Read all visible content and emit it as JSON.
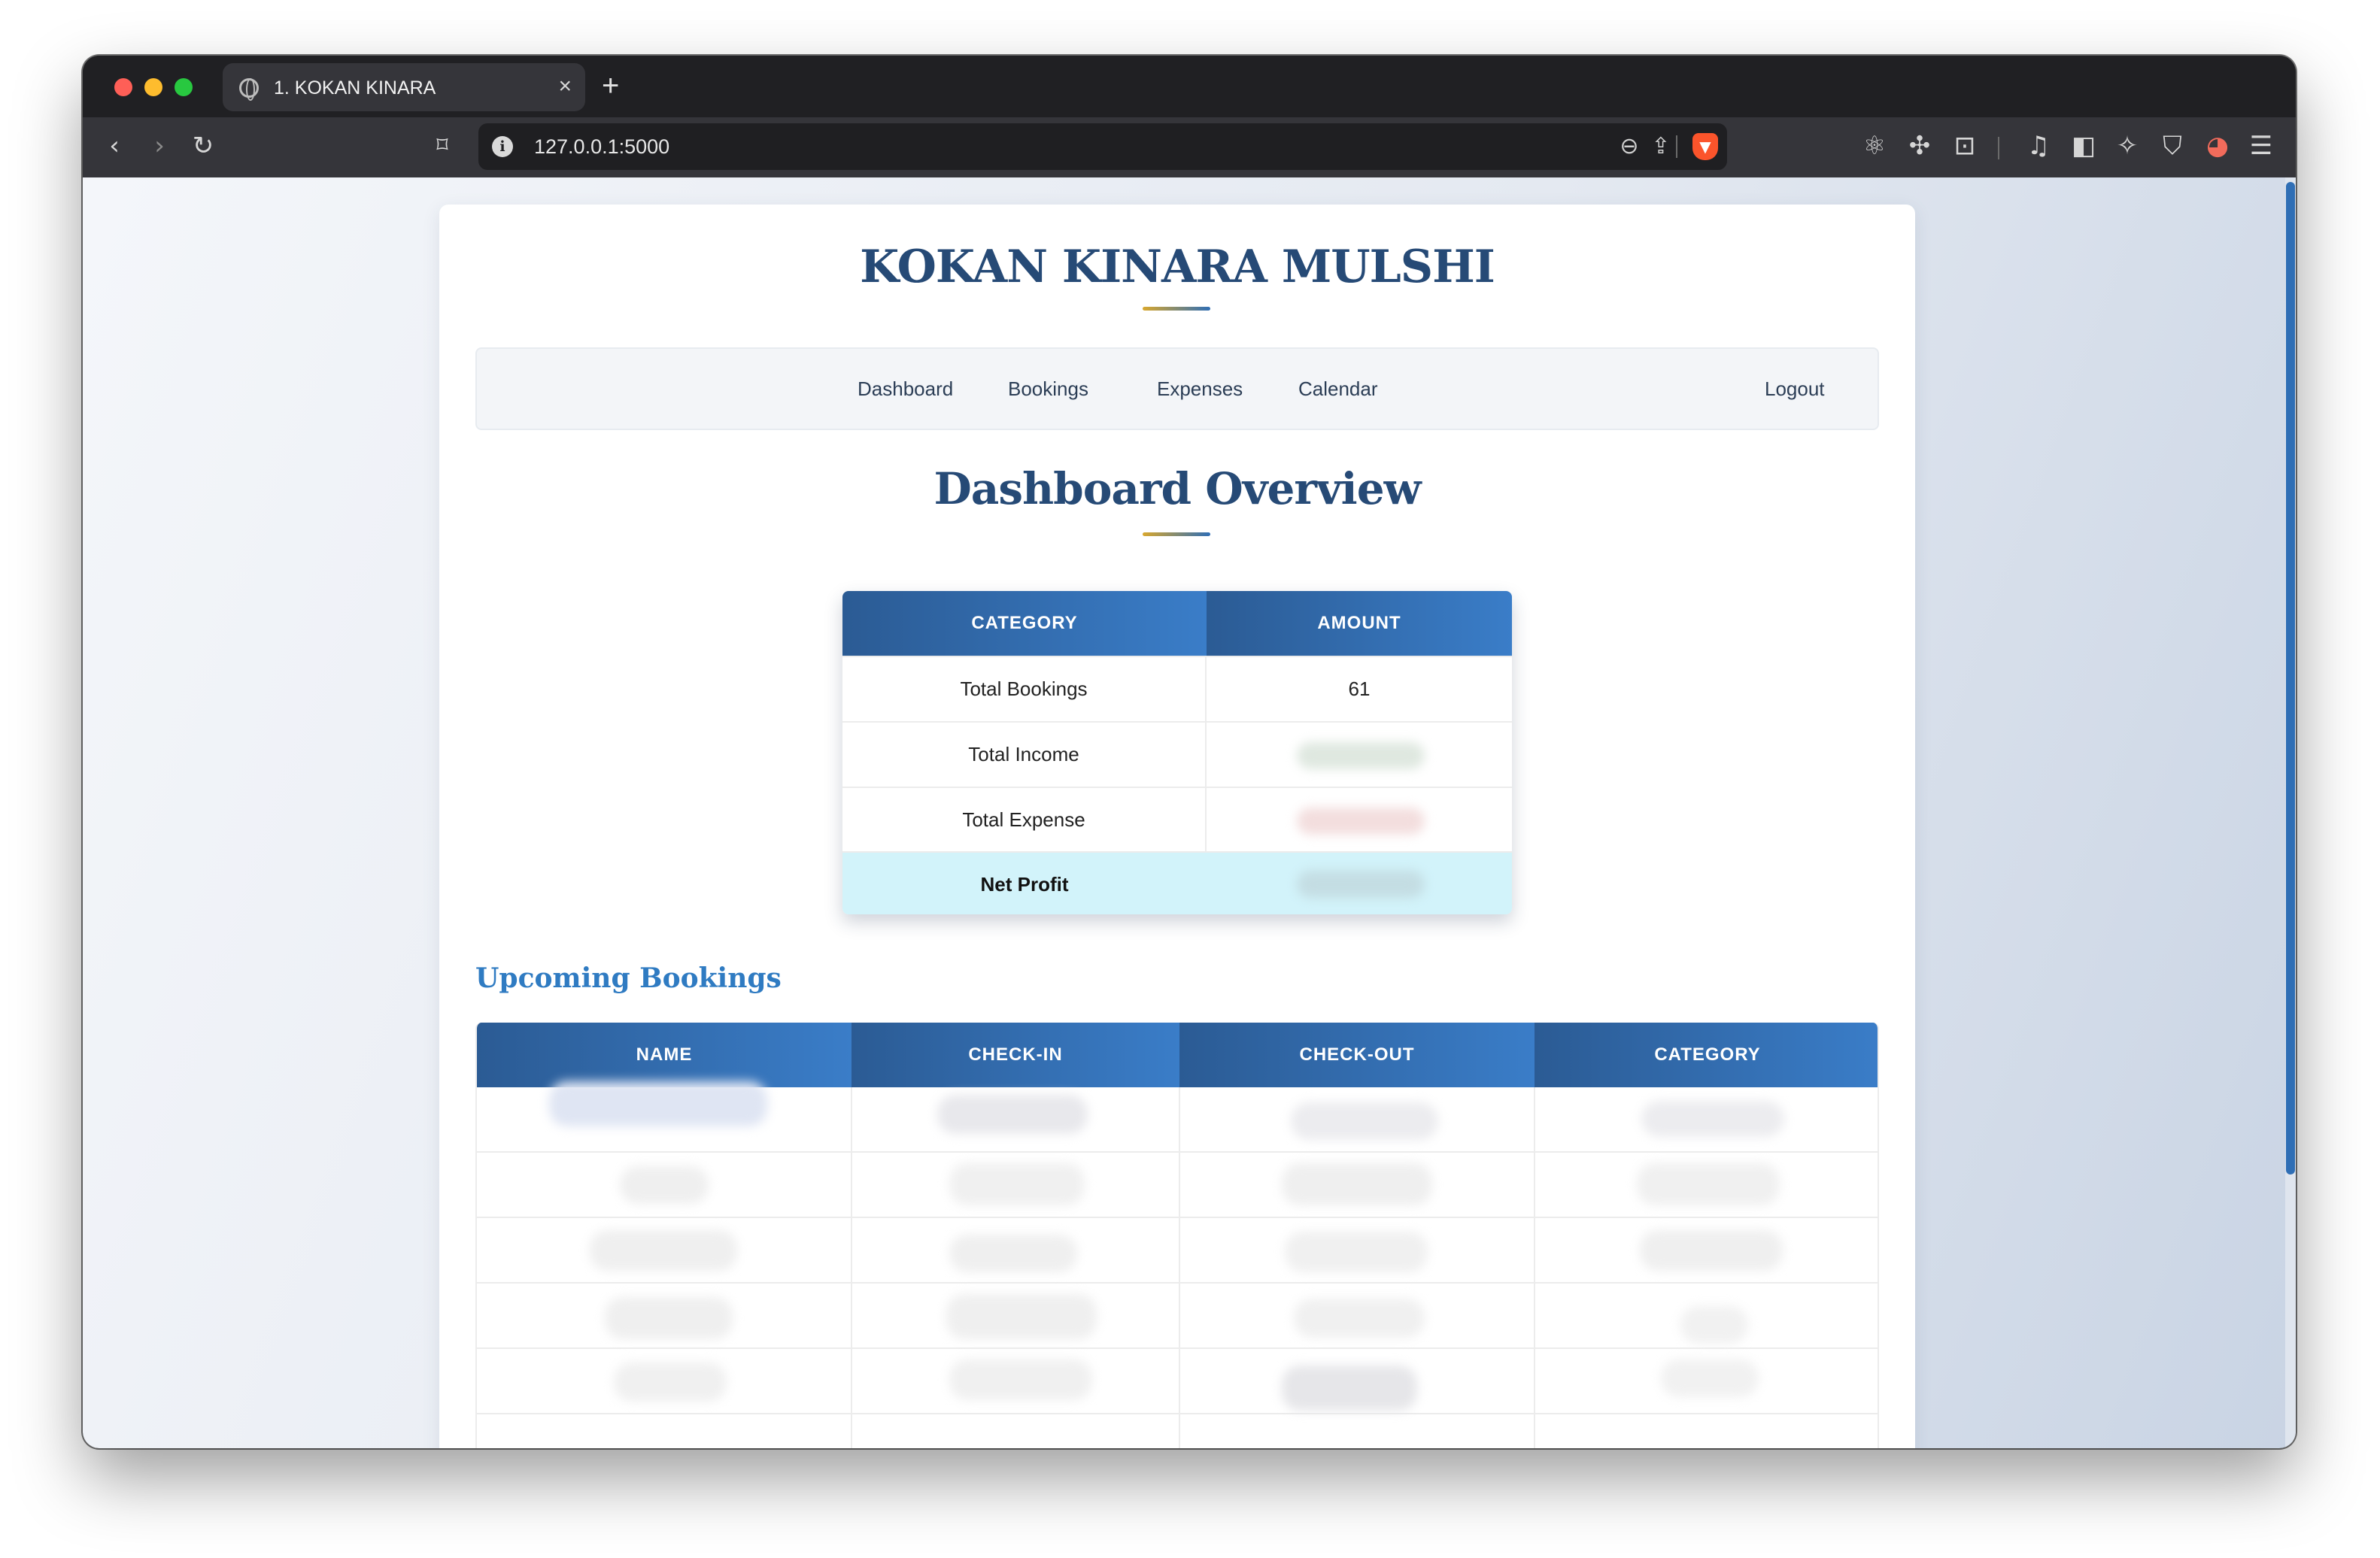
{
  "browser": {
    "tab_title": "1. KOKAN KINARA",
    "tab_close": "×",
    "new_tab": "+",
    "url": "127.0.0.1:5000"
  },
  "site": {
    "title": "KOKAN KINARA MULSHI"
  },
  "nav": {
    "items": [
      "Dashboard",
      "Bookings",
      "Expenses",
      "Calendar"
    ],
    "logout": "Logout"
  },
  "dashboard": {
    "title": "Dashboard Overview",
    "summary": {
      "headers": [
        "CATEGORY",
        "AMOUNT"
      ],
      "rows": [
        {
          "category": "Total Bookings",
          "amount": "61"
        },
        {
          "category": "Total Income",
          "amount": ""
        },
        {
          "category": "Total Expense",
          "amount": ""
        },
        {
          "category": "Net Profit",
          "amount": ""
        }
      ]
    }
  },
  "upcoming": {
    "title": "Upcoming Bookings",
    "headers": [
      "NAME",
      "CHECK-IN",
      "CHECK-OUT",
      "CATEGORY"
    ]
  },
  "colors": {
    "accent": "#2f6eb5",
    "title": "#264a76",
    "net_profit_bg": "#d2f3fa"
  }
}
